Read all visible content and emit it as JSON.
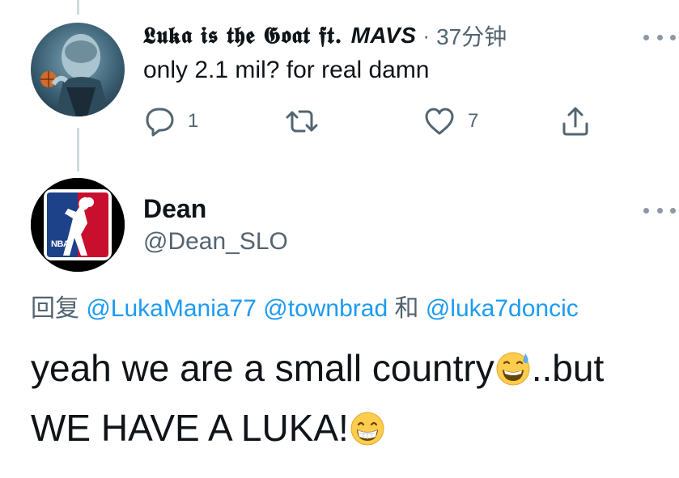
{
  "parent_tweet": {
    "display_name_gothic": "𝕷𝖚𝖐𝖆 𝖎𝖘 𝖙𝖍𝖊 𝕲𝖔𝖆𝖙 𝖋𝖙.",
    "display_name_italic": "MAVS",
    "separator": "·",
    "time": "37分钟",
    "text": "only 2.1 mil? for real damn",
    "reply_count": "1",
    "retweet_count": "",
    "like_count": "7"
  },
  "main_tweet": {
    "display_name": "Dean",
    "handle": "@Dean_SLO",
    "replying_prefix": "回复",
    "mentions": [
      "@LukaMania77",
      "@townbrad",
      "@luka7doncic"
    ],
    "conjunction": "和",
    "text_line1": "yeah we are a small country",
    "text_line1_after": "..but",
    "text_line2": "WE HAVE A LUKA!",
    "avatar_logo_text": "NBA"
  },
  "icons": {
    "reply": "speech-bubble-icon",
    "retweet": "retweet-icon",
    "like": "heart-icon",
    "share": "share-icon",
    "more": "more-dots-icon",
    "emoji1": "grinning-face-with-sweat-emoji",
    "emoji2": "beaming-face-emoji"
  },
  "colors": {
    "link": "#1d9bf0",
    "secondary": "#536471",
    "thread_line": "#cfd9de",
    "nba_blue": "#1d428a",
    "nba_red": "#c8102e"
  }
}
